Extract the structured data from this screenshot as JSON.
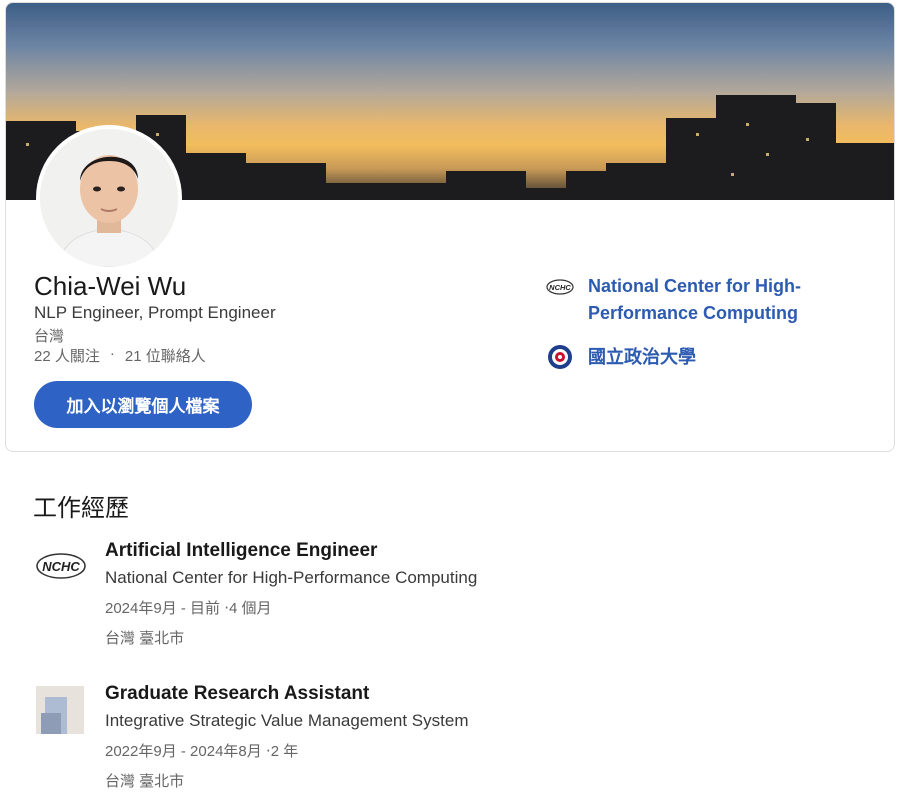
{
  "profile": {
    "name": "Chia-Wei Wu",
    "headline": "NLP Engineer, Prompt Engineer",
    "location": "台灣",
    "followers": "22 人關注",
    "separator": "·",
    "connections": "21 位聯絡人",
    "join_button": "加入以瀏覽個人檔案"
  },
  "organizations": [
    {
      "name": "National Center for High-Performance Computing",
      "name_line1": "National Center for High-",
      "name_line2": "Performance Computing",
      "logo_text": "NCHC",
      "icon": "nchc-logo-icon"
    },
    {
      "name": "國立政治大學",
      "icon": "nccu-seal-icon"
    }
  ],
  "experience_section": {
    "title": "工作經歷",
    "items": [
      {
        "title": "Artificial Intelligence Engineer",
        "company": "National Center for High-Performance Computing",
        "dates": "2024年9月 - 目前 ‧4 個月",
        "location": "台灣 臺北市",
        "logo_text": "NCHC",
        "icon": "nchc-logo-icon"
      },
      {
        "title": "Graduate Research Assistant",
        "company": "Integrative Strategic Value Management System",
        "dates": "2022年9月 - 2024年8月 ‧2 年",
        "location": "台灣 臺北市",
        "icon": "company-placeholder-icon"
      }
    ]
  },
  "colors": {
    "accent": "#2e62c5",
    "link": "#2c5bb0",
    "text_primary": "#191919",
    "text_secondary": "#666666"
  }
}
